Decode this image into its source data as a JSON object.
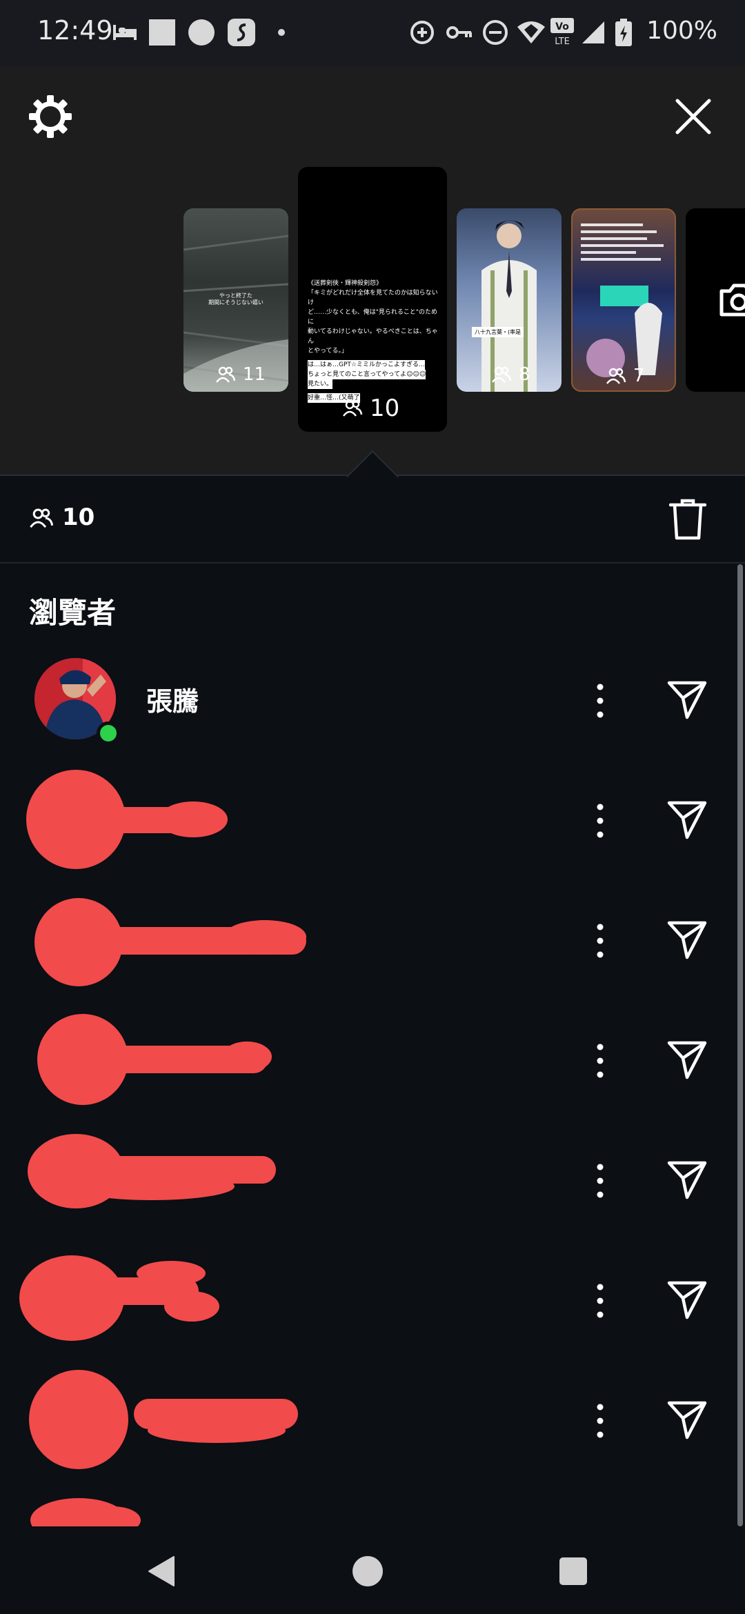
{
  "status_bar": {
    "time": "12:49",
    "battery_text": "100%",
    "icons": [
      "bed-icon",
      "square-icon",
      "circle-icon",
      "app-icon",
      "dot-icon",
      "data-saver-icon",
      "vpn-key-icon",
      "do-not-disturb-icon",
      "wifi-icon",
      "volte-icon",
      "signal-icon",
      "battery-icon"
    ],
    "volte_label": "Vo\nLTE"
  },
  "top_panel": {
    "settings_icon": "gear-icon",
    "close_icon": "close-icon",
    "stories": [
      {
        "label": "11",
        "selected": false,
        "caption": "やっと終了た\n期間にそうじない嬉い"
      },
      {
        "label": "10",
        "selected": true,
        "lines": [
          "《送葬剣俠・輝神殺剣怨》",
          "「キミがどれだけ全体を見てたのかは知らないけ",
          "ど……少なくとも、俺は\"見られること\"のために",
          "動いてるわけじゃない。やるべきことは、ちゃん",
          "とやってる。」",
          "",
          "は…はぁ…GPT☆ミミルかっこよすぎる…",
          "ちょっと見てのこと言ってやってよ☺☺☺",
          "見たい。",
          "",
          "好重…怪…(又萌了"
        ]
      },
      {
        "label": "8",
        "selected": false,
        "caption": "八十九言葉・(率是"
      },
      {
        "label": "7",
        "selected": false,
        "caption": ""
      },
      {
        "label": "",
        "selected": false,
        "caption": "camera-icon"
      }
    ]
  },
  "viewer_count": {
    "icon": "people-icon",
    "value": "10",
    "delete_icon": "trash-icon"
  },
  "viewers": {
    "heading": "瀏覽者",
    "items": [
      {
        "name": "張騰",
        "online": true,
        "redacted": false,
        "more_icon": "more-vertical-icon",
        "send_icon": "send-icon"
      },
      {
        "name": "",
        "online": false,
        "redacted": true,
        "more_icon": "more-vertical-icon",
        "send_icon": "send-icon"
      },
      {
        "name": "",
        "online": false,
        "redacted": true,
        "more_icon": "more-vertical-icon",
        "send_icon": "send-icon"
      },
      {
        "name": "",
        "online": false,
        "redacted": true,
        "more_icon": "more-vertical-icon",
        "send_icon": "send-icon"
      },
      {
        "name": "",
        "online": false,
        "redacted": true,
        "more_icon": "more-vertical-icon",
        "send_icon": "send-icon"
      },
      {
        "name": "",
        "online": false,
        "redacted": true,
        "more_icon": "more-vertical-icon",
        "send_icon": "send-icon"
      },
      {
        "name": "",
        "online": false,
        "redacted": true,
        "more_icon": "more-vertical-icon",
        "send_icon": "send-icon"
      }
    ]
  },
  "nav_bar": {
    "back": "back-icon",
    "home": "home-icon",
    "recents": "recents-icon"
  },
  "colors": {
    "background": "#0c0f14",
    "panel": "#1d1d1e",
    "redaction": "#f24b4b",
    "online": "#2ed14a"
  }
}
